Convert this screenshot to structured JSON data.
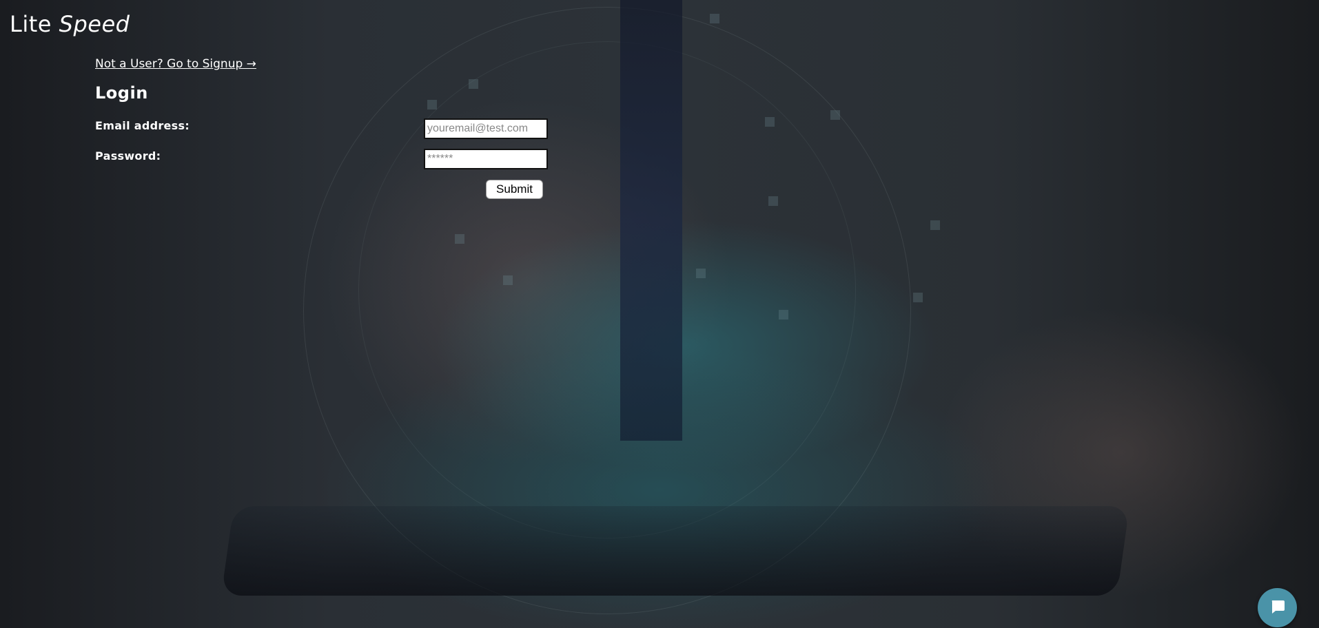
{
  "brand": {
    "part1": "Lite",
    "part2": "Speed"
  },
  "signup_link": "Not a User? Go to Signup →",
  "heading": "Login",
  "form": {
    "email": {
      "label": "Email address:",
      "placeholder": "youremail@test.com",
      "value": ""
    },
    "password": {
      "label": "Password:",
      "placeholder": "******",
      "value": ""
    },
    "submit_label": "Submit"
  },
  "chat": {
    "icon": "chat-bubble-icon",
    "color": "#4a93a8"
  },
  "colors": {
    "text": "#ffffff",
    "background": "#2a2f35"
  }
}
